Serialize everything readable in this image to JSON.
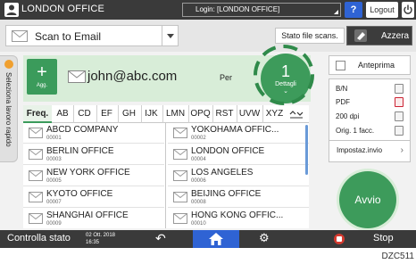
{
  "topbar": {
    "title": "LONDON OFFICE",
    "login_text": "Login: [LONDON OFFICE]",
    "help": "?",
    "logout": "Logout"
  },
  "funcbar": {
    "function": "Scan to Email",
    "stato": "Stato file scans.",
    "azzera": "Azzera"
  },
  "sidetab": {
    "label": "Seleziona lavoro rapido"
  },
  "destination": {
    "add_label": "Agg.",
    "email": "john@abc.com",
    "per": "Per",
    "count": "1",
    "details_label": "Dettagli"
  },
  "tabs": [
    {
      "label": "Freq.",
      "selected": true
    },
    {
      "label": "AB"
    },
    {
      "label": "CD"
    },
    {
      "label": "EF"
    },
    {
      "label": "GH"
    },
    {
      "label": "IJK"
    },
    {
      "label": "LMN"
    },
    {
      "label": "OPQ"
    },
    {
      "label": "RST"
    },
    {
      "label": "UVW"
    },
    {
      "label": "XYZ"
    }
  ],
  "addresses": [
    {
      "name": "ABCD COMPANY",
      "num": "00001"
    },
    {
      "name": "YOKOHAMA OFFIC...",
      "num": "00002"
    },
    {
      "name": "BERLIN OFFICE",
      "num": "00003"
    },
    {
      "name": "LONDON OFFICE",
      "num": "00004"
    },
    {
      "name": "NEW YORK OFFICE",
      "num": "00005"
    },
    {
      "name": "LOS ANGELES",
      "num": "00006"
    },
    {
      "name": "KYOTO OFFICE",
      "num": "00007"
    },
    {
      "name": "BEIJING OFFICE",
      "num": "00008"
    },
    {
      "name": "SHANGHAI OFFICE",
      "num": "00009"
    },
    {
      "name": "HONG KONG OFFIC...",
      "num": "00010"
    }
  ],
  "settings": {
    "preview": "Anteprima",
    "color": "B/N",
    "format": "PDF",
    "resolution": "200 dpi",
    "original": "Orig. 1 facc.",
    "send_settings": "Impostaz.invio",
    "start": "Avvio"
  },
  "bottombar": {
    "status": "Controlla stato",
    "date": "02 Ott. 2018",
    "time": "16:35",
    "stop": "Stop"
  },
  "figure_code": "DZC511",
  "colors": {
    "accent_green": "#3d9b5b",
    "home_blue": "#2f63d4",
    "stop_red": "#d43a2f"
  }
}
